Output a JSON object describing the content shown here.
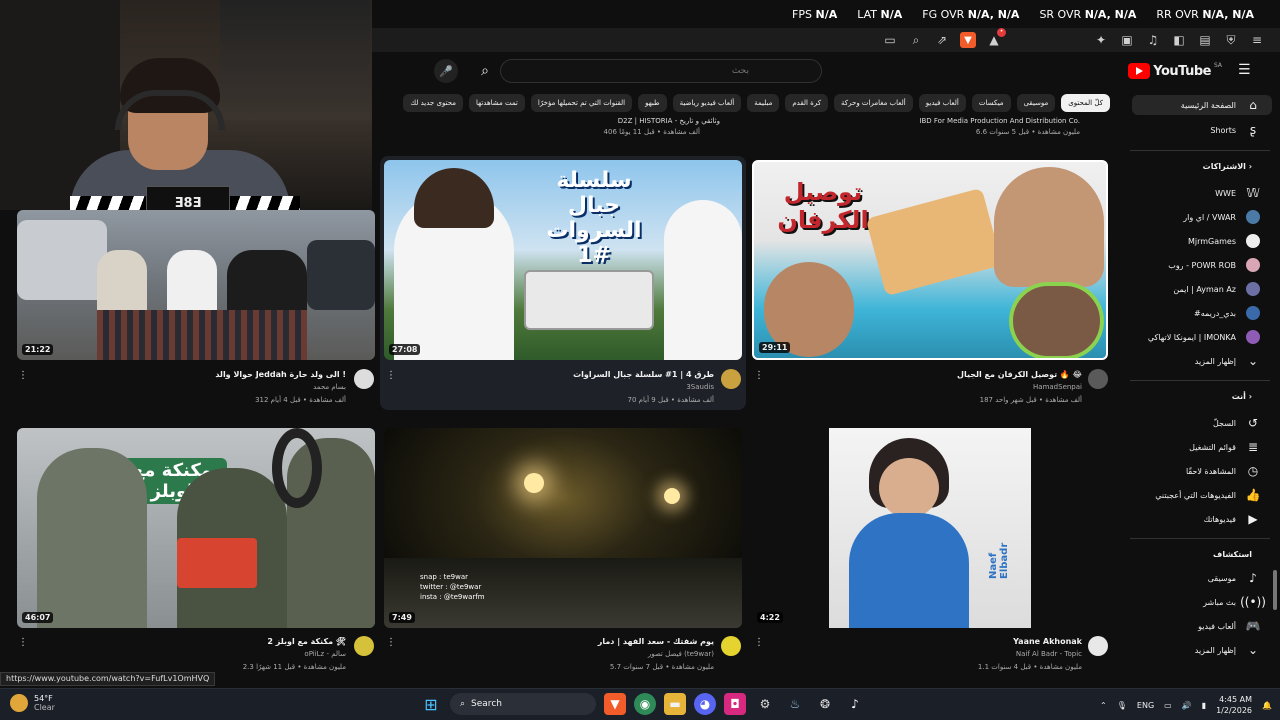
{
  "overlay": {
    "stats": [
      {
        "label": "FPS",
        "value": "N/A"
      },
      {
        "label": "LAT",
        "value": "N/A"
      },
      {
        "label": "FG OVR",
        "value": "N/A, N/A"
      },
      {
        "label": "SR OVR",
        "value": "N/A, N/A"
      },
      {
        "label": "RR OVR",
        "value": "N/A, N/A"
      }
    ]
  },
  "webcam": {
    "logo_text": "Ǝ8Ǝ"
  },
  "youtube": {
    "logo_text": "YouTube",
    "region": "SA",
    "search_placeholder": "بحث",
    "chips": [
      "كلّ المحتوى",
      "موسيقى",
      "ميكسات",
      "ألعاب فيديو",
      "ألعاب مغامرات وحركة",
      "كرة القدم",
      "مبليمة",
      "ألعاب فيديو رياضية",
      "طبهو",
      "القنوات التي تم تحميلها مؤخرًا",
      "تمت مشاهدتها",
      "محتوى جديد لك"
    ],
    "prev_row": {
      "left_channel": "D2Z | HISTORIA - وثائقي و تاريخ",
      "left_meta": "406 ألف مشاهدة • قبل 11 يومًا",
      "right_channel": "IBD For Media Production And Distribution Co.",
      "right_meta": "6.6 مليون مشاهدة • قبل 5 سنوات"
    },
    "videos": [
      {
        "duration": "21:22",
        "title": "حوالا والد Jeddah الى ولد حارة !",
        "channel": "بسام محمد",
        "meta": "312 ألف مشاهدة • قبل 4 أيام"
      },
      {
        "duration": "27:08",
        "title": "طرق 4 | 1# سلسلة جبال السراوات",
        "channel": "3Saudis",
        "meta": "70 ألف مشاهدة • قبل 9 أيام",
        "art": "سلسلة جبال السروات 1#"
      },
      {
        "duration": "29:11",
        "title": "توصيل الكرفان مع الجيال 🔥 😂",
        "channel": "HamadSenpai",
        "meta": "187 ألف مشاهدة • قبل شهر واحد",
        "art": "توصيل الكرفان"
      },
      {
        "duration": "46:07",
        "title": "مكنكة مع اوبلز 2 🛠",
        "channel": "oPiiLz - سالم",
        "meta": "2.3 مليون مشاهدة • قبل 11 شهرًا",
        "art": "مكنكة مع اوبلز"
      },
      {
        "duration": "7:49",
        "title": "يوم شفتك - سعد الفهد | دمار",
        "channel": "فيصل تصور (te9war)",
        "meta": "5.7 مليون مشاهدة • قبل 7 سنوات",
        "overlay_lines": [
          "snap : te9war",
          "twitter : @te9war",
          "insta : @te9warfm"
        ]
      },
      {
        "duration": "4:22",
        "title": "Yaane Akhonak",
        "channel": "Naif Al Badr - Topic",
        "meta": "1.1 مليون مشاهدة • قبل 4 سنوات",
        "art": "Naef Elbadr"
      }
    ],
    "sidebar": {
      "home": "الصفحة الرئيسية",
      "shorts": "Shorts",
      "subs_header": "الاشتراكات",
      "subscriptions": [
        "WWE",
        "اي وار / VWAR",
        "MjrmGames",
        "روب - POWR ROB",
        "ايمن | Ayman Az",
        "#بدي_دريمه",
        "ايمونكا لاتهاكي | IMONKA"
      ],
      "show_more": "إظهار المزيد",
      "you_header": "أنت",
      "you_items": [
        "السجلّ",
        "قوائم التشغيل",
        "المشاهدة لاحقًا",
        "الفيديوهات التي أعجبتني",
        "فيديوهاتك"
      ],
      "explore_header": "استكشاف",
      "explore_items": [
        "موسيقى",
        "بث مباشر",
        "ألعاب فيديو",
        "إظهار المزيد"
      ]
    }
  },
  "status_url": "https://www.youtube.com/watch?v=FufLv1OmHVQ",
  "taskbar": {
    "temp": "54°F",
    "weather": "Clear",
    "search": "Search",
    "lang": "ENG",
    "time": "4:45 AM",
    "date": "1/2/2026"
  }
}
